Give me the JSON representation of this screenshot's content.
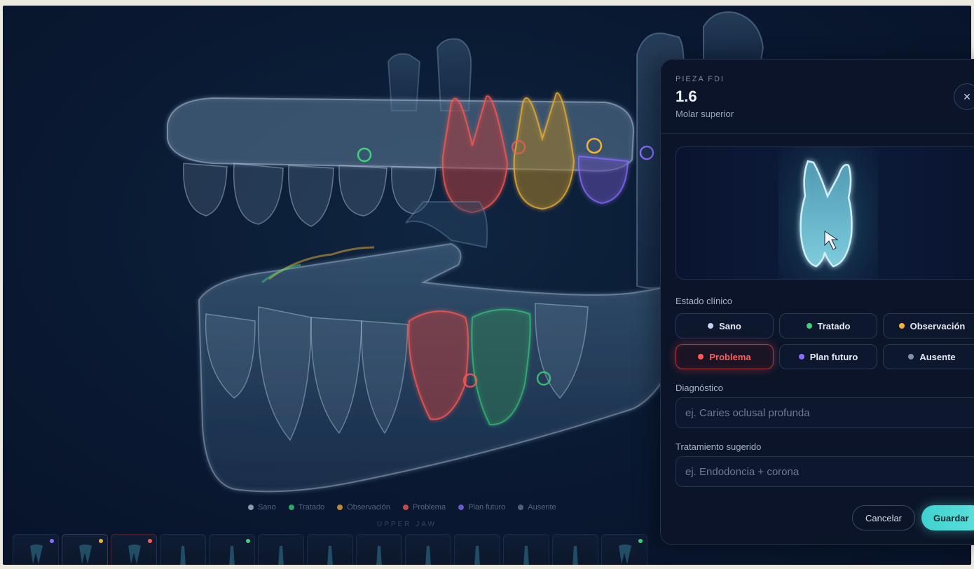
{
  "legend": [
    {
      "label": "Sano",
      "color": "#b8c4d6"
    },
    {
      "label": "Tratado",
      "color": "#3ed27a"
    },
    {
      "label": "Observación",
      "color": "#f2b233"
    },
    {
      "label": "Problema",
      "color": "#ff5a54"
    },
    {
      "label": "Plan futuro",
      "color": "#8a6cff"
    },
    {
      "label": "Ausente",
      "color": "#6b7790"
    }
  ],
  "jaw_label": "UPPER JAW",
  "colors": {
    "accent": "#4dd8d4",
    "problem": "#ff5a54",
    "treated": "#3ed27a",
    "observation": "#f2b233",
    "future": "#8a6cff"
  },
  "panel": {
    "eyebrow": "PIEZA FDI",
    "tooth_number": "1.6",
    "tooth_type": "Molar superior",
    "close_icon": "close-icon",
    "estado_label": "Estado clínico",
    "statuses": [
      {
        "label": "Sano",
        "color": "#c5d3ee",
        "active": false
      },
      {
        "label": "Tratado",
        "color": "#3ed27a",
        "active": false
      },
      {
        "label": "Observación",
        "color": "#f2b233",
        "active": false
      },
      {
        "label": "Problema",
        "color": "#ff5a54",
        "active": true
      },
      {
        "label": "Plan futuro",
        "color": "#8a6cff",
        "active": false
      },
      {
        "label": "Ausente",
        "color": "#8591a8",
        "active": false
      }
    ],
    "diagnostico_label": "Diagnóstico",
    "diagnostico_placeholder": "ej. Caries oclusal profunda",
    "diagnostico_value": "",
    "tratamiento_label": "Tratamiento sugerido",
    "tratamiento_placeholder": "ej. Endodoncia + corona",
    "tratamiento_value": "",
    "cancel_label": "Cancelar",
    "save_label": "Guardar"
  }
}
